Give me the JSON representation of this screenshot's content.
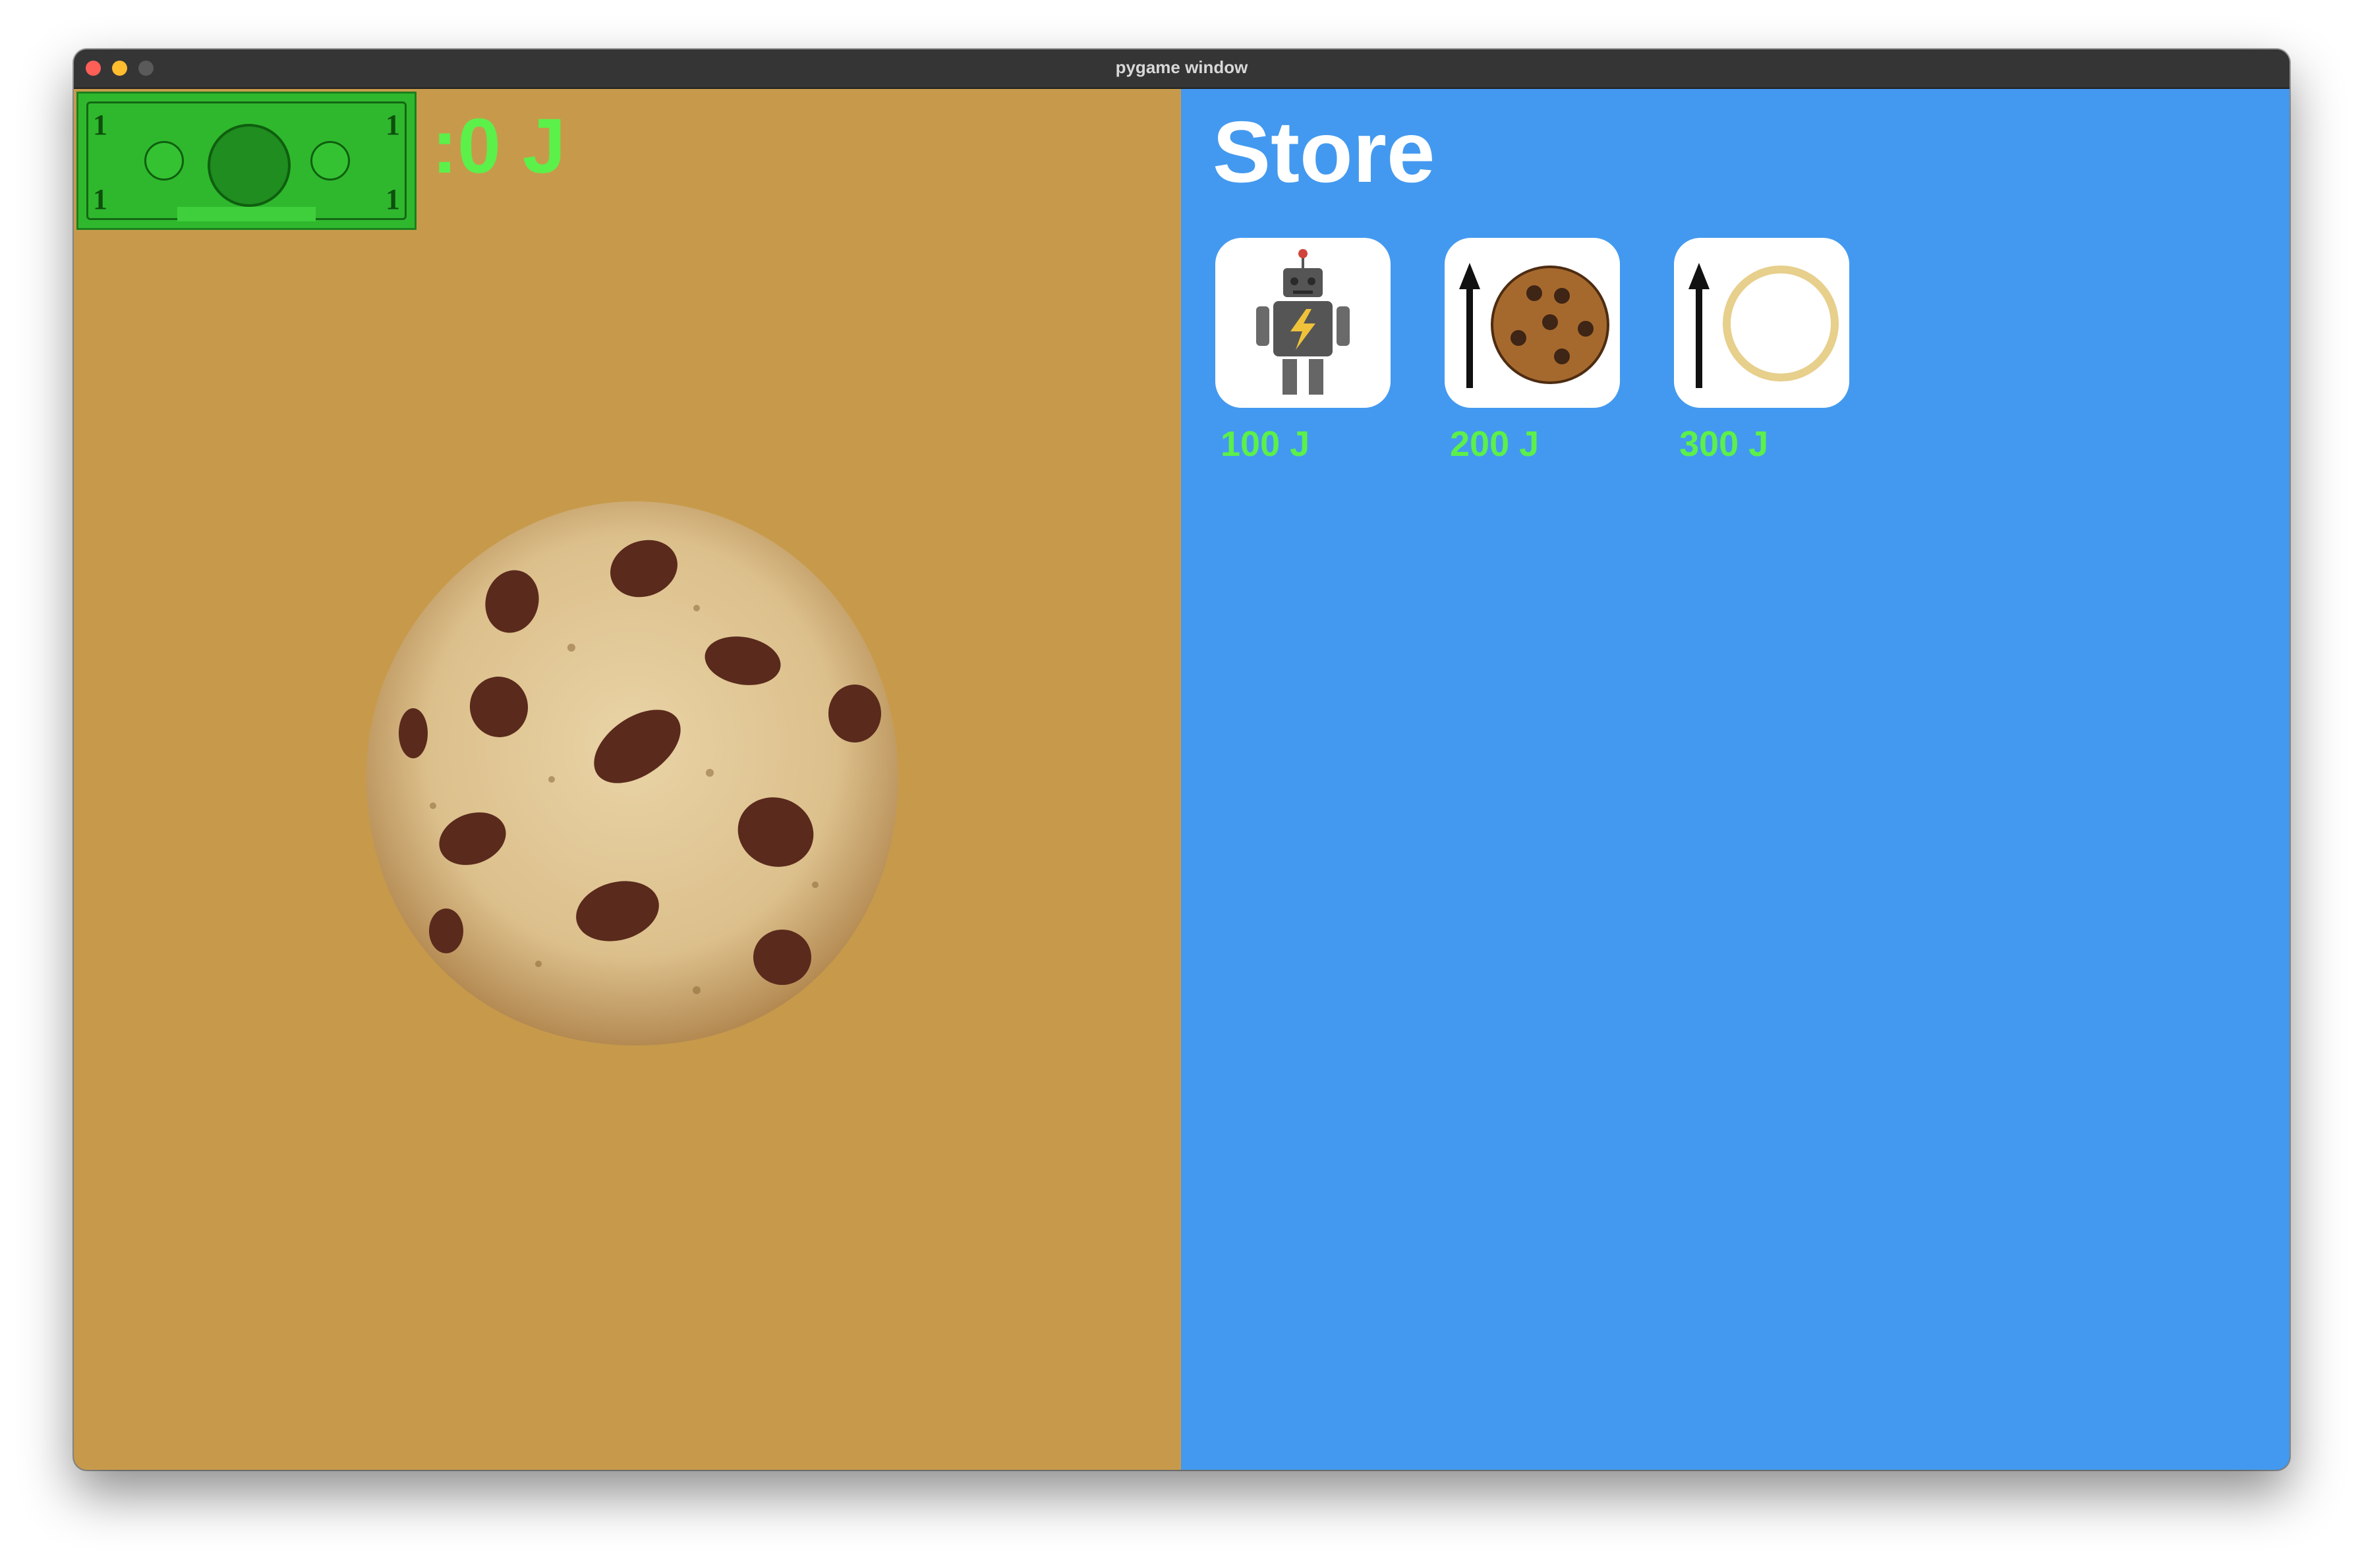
{
  "window": {
    "title": "pygame window"
  },
  "game": {
    "money_icon": "dollar-bill-icon",
    "money_text": ":0 J",
    "cookie_icon": "chocolate-chip-cookie-icon"
  },
  "store": {
    "title": "Store",
    "items": [
      {
        "icon": "robot-icon",
        "price": "100 J"
      },
      {
        "icon": "cookie-upgrade-icon",
        "price": "200 J"
      },
      {
        "icon": "plate-upgrade-icon",
        "price": "300 J"
      }
    ]
  },
  "colors": {
    "game_bg": "#c79a4b",
    "store_bg": "#4399ef",
    "money_text": "#5cf04a",
    "price_text": "#5cf04a"
  }
}
